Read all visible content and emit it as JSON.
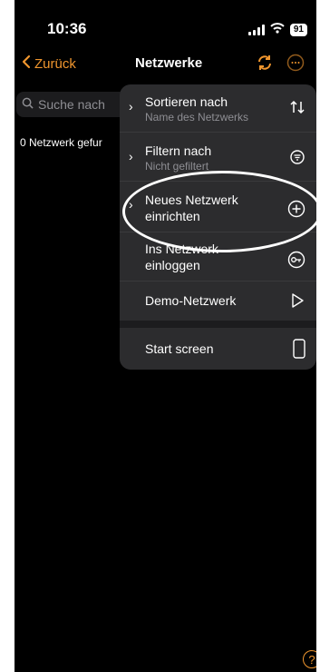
{
  "status": {
    "time": "10:36",
    "battery": "91"
  },
  "nav": {
    "back_label": "Zurück",
    "title": "Netzwerke"
  },
  "search": {
    "placeholder": "Suche nach"
  },
  "list": {
    "count_text": "0 Netzwerk gefur"
  },
  "menu": {
    "items": [
      {
        "label": "Sortieren nach",
        "sub": "Name des Netzwerks",
        "icon": "sort-icon"
      },
      {
        "label": "Filtern nach",
        "sub": "Nicht gefiltert",
        "icon": "filter-icon"
      },
      {
        "label": "Neues Netzwerk",
        "label2": "einrichten",
        "icon": "plus-circle-icon"
      },
      {
        "label": "Ins Netzwerk",
        "label2": "einloggen",
        "icon": "key-icon"
      },
      {
        "label": "Demo-Netzwerk",
        "icon": "play-icon"
      },
      {
        "label": "Start screen",
        "icon": "phone-icon"
      }
    ]
  },
  "colors": {
    "accent": "#f0962e",
    "menu_bg": "#2c2c2e",
    "background": "#000000"
  },
  "help": {
    "label": "?"
  }
}
